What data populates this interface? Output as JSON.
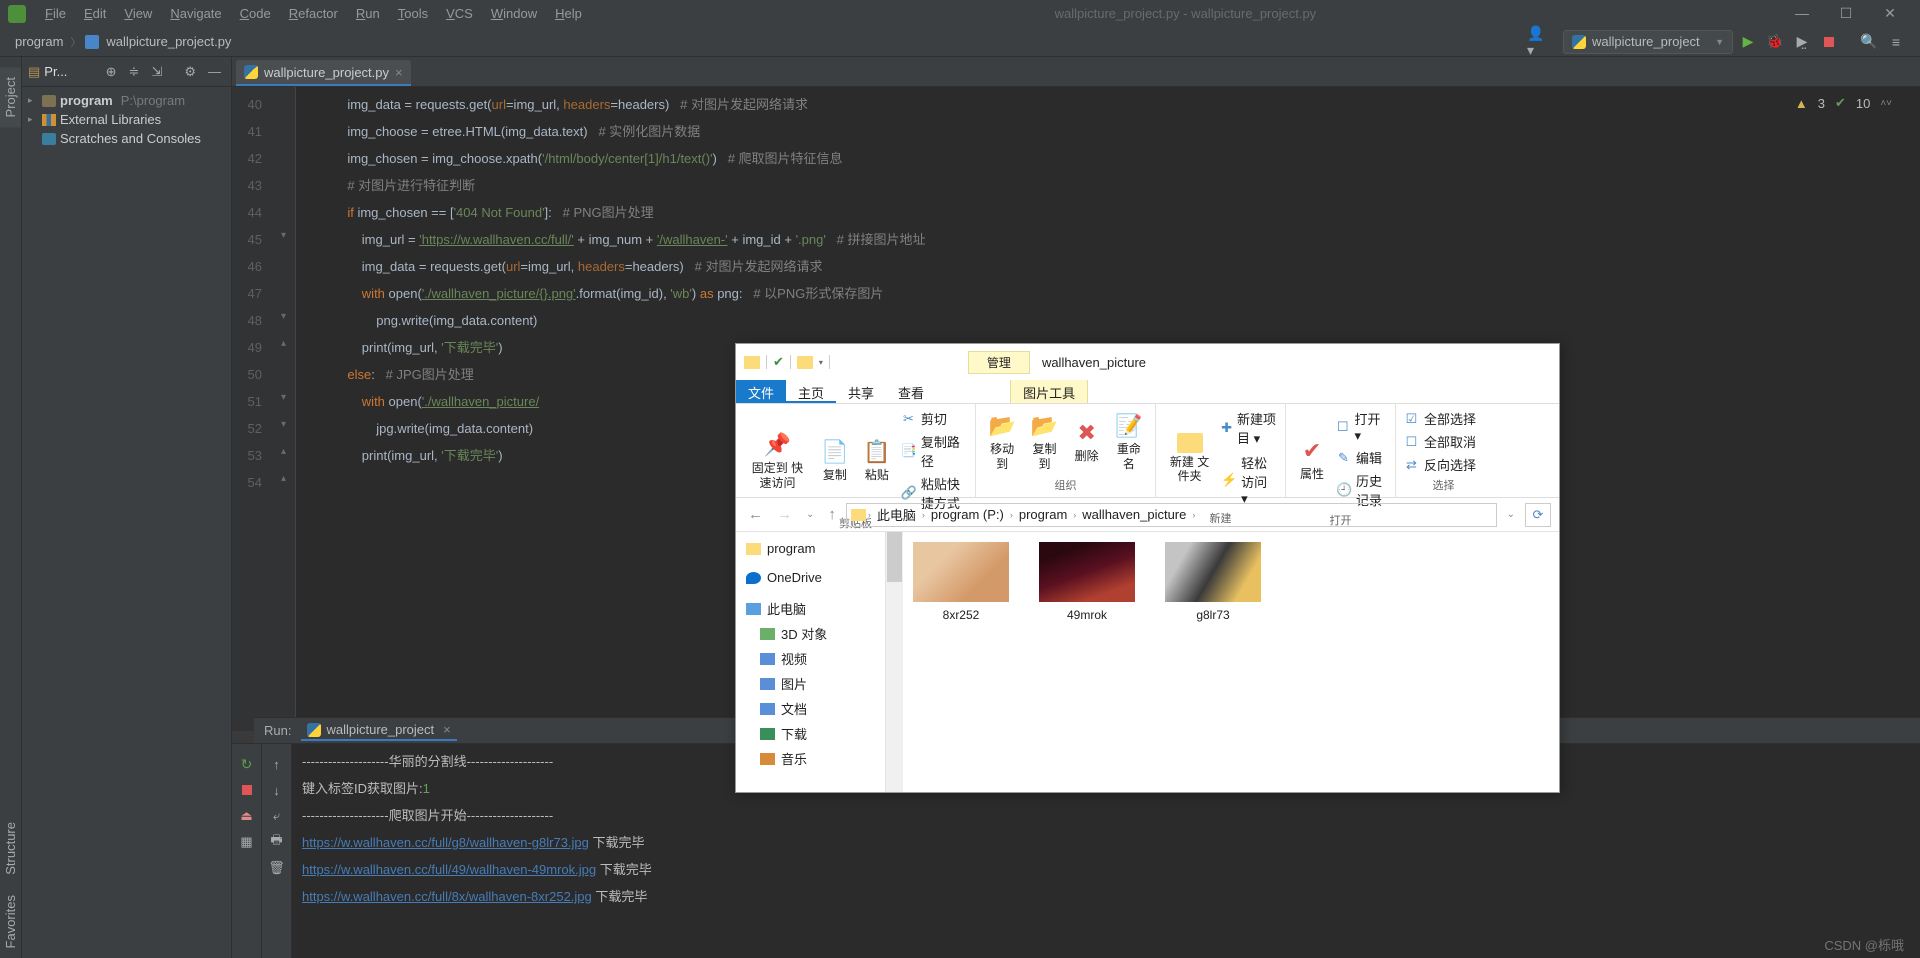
{
  "titlebar": {
    "menus": [
      "File",
      "Edit",
      "View",
      "Navigate",
      "Code",
      "Refactor",
      "Run",
      "Tools",
      "VCS",
      "Window",
      "Help"
    ],
    "title": "wallpicture_project.py - wallpicture_project.py"
  },
  "breadcrumb": {
    "root": "program",
    "file": "wallpicture_project.py"
  },
  "run_config": "wallpicture_project",
  "inspection": {
    "warn": "3",
    "ok": "10"
  },
  "project": {
    "label": "Pr...",
    "root": "program",
    "root_path": "P:\\program",
    "libs": "External Libraries",
    "scratch": "Scratches and Consoles"
  },
  "tab_file": "wallpicture_project.py",
  "lines": {
    "start": 40,
    "end": 54
  },
  "code": [
    {
      "ln": 40,
      "raw": "            img_data = requests.get(<na>url</na>=img_url, <na>headers</na>=headers)   <cm># 对图片发起网络请求</cm>"
    },
    {
      "ln": 41,
      "raw": "            img_choose = etree.HTML(img_data.text)   <cm># 实例化图片数据</cm>"
    },
    {
      "ln": 42,
      "raw": "            img_chosen = img_choose.xpath(<str>'/html/body/center[1]/h1/text()'</str>)   <cm># 爬取图片特征信息</cm>"
    },
    {
      "ln": 43,
      "raw": ""
    },
    {
      "ln": 44,
      "raw": "            <cm># 对图片进行特征判断</cm>"
    },
    {
      "ln": 45,
      "raw": "            <kw>if</kw> img_chosen == [<str>'404 Not Found'</str>]:   <cm># PNG图片处理</cm>"
    },
    {
      "ln": 46,
      "raw": "                img_url = <strU>'https://w.wallhaven.cc/full/'</strU> + img_num + <strU>'/wallhaven-'</strU> + img_id + <str>'.png'</str>   <cm># 拼接图片地址</cm>"
    },
    {
      "ln": 47,
      "raw": "                img_data = requests.get(<na>url</na>=img_url, <na>headers</na>=headers)   <cm># 对图片发起网络请求</cm>"
    },
    {
      "ln": 48,
      "raw": "                <kw>with</kw> open(<strU>'./wallhaven_picture/{}.png'</strU>.format(img_id), <str>'wb'</str>) <kw>as</kw> png:   <cm># 以PNG形式保存图片</cm>"
    },
    {
      "ln": 49,
      "raw": "                    png.write(img_data.content)"
    },
    {
      "ln": 50,
      "raw": "                print(img_url, <str>'下载完毕'</str>)"
    },
    {
      "ln": 51,
      "raw": "            <kw>else</kw>:   <cm># JPG图片处理</cm>"
    },
    {
      "ln": 52,
      "raw": "                <kw>with</kw> open(<strU>'./wallhaven_picture/</strU>"
    },
    {
      "ln": 53,
      "raw": "                    jpg.write(img_data.content)"
    },
    {
      "ln": 54,
      "raw": "                print(img_url, <str>'下载完毕'</str>)"
    }
  ],
  "run": {
    "label": "Run:",
    "tab": "wallpicture_project",
    "lines": [
      {
        "t": "plain",
        "v": "--------------------华丽的分割线--------------------"
      },
      {
        "t": "prompt",
        "v": "键入标签ID获取图片:",
        "in": "1"
      },
      {
        "t": "plain",
        "v": "--------------------爬取图片开始--------------------"
      },
      {
        "t": "link",
        "v": "https://w.wallhaven.cc/full/g8/wallhaven-g8lr73.jpg",
        "s": "下载完毕"
      },
      {
        "t": "link",
        "v": "https://w.wallhaven.cc/full/49/wallhaven-49mrok.jpg",
        "s": "下载完毕"
      },
      {
        "t": "link",
        "v": "https://w.wallhaven.cc/full/8x/wallhaven-8xr252.jpg",
        "s": "下载完毕"
      }
    ]
  },
  "sideTabs": {
    "project": "Project",
    "structure": "Structure",
    "favorites": "Favorites"
  },
  "explorer": {
    "manage": "管理",
    "title": "wallhaven_picture",
    "tabs": {
      "file": "文件",
      "home": "主页",
      "share": "共享",
      "view": "查看",
      "pictool": "图片工具"
    },
    "ribbon": {
      "pin": "固定到\n快速访问",
      "copy": "复制",
      "paste": "粘贴",
      "cut": "剪切",
      "copypath": "复制路径",
      "pasteshort": "粘贴快捷方式",
      "moveto": "移动到",
      "copyto": "复制到",
      "delete": "删除",
      "rename": "重命名",
      "newfolder": "新建\n文件夹",
      "newitem": "新建项目 ▾",
      "easyaccess": "轻松访问 ▾",
      "props": "属性",
      "open": "打开 ▾",
      "edit": "编辑",
      "history": "历史记录",
      "selall": "全部选择",
      "selnone": "全部取消",
      "selinv": "反向选择",
      "g_clip": "剪贴板",
      "g_org": "组织",
      "g_new": "新建",
      "g_open": "打开",
      "g_sel": "选择"
    },
    "path": [
      "此电脑",
      "program (P:)",
      "program",
      "wallhaven_picture"
    ],
    "nav": {
      "program": "program",
      "onedrive": "OneDrive",
      "pc": "此电脑",
      "obj": "3D 对象",
      "video": "视频",
      "pic": "图片",
      "doc": "文档",
      "dl": "下载",
      "music": "音乐"
    },
    "files": [
      {
        "name": "8xr252",
        "t": "t1"
      },
      {
        "name": "49mrok",
        "t": "t2"
      },
      {
        "name": "g8lr73",
        "t": "t3"
      }
    ]
  },
  "watermark": "CSDN @栎哦"
}
